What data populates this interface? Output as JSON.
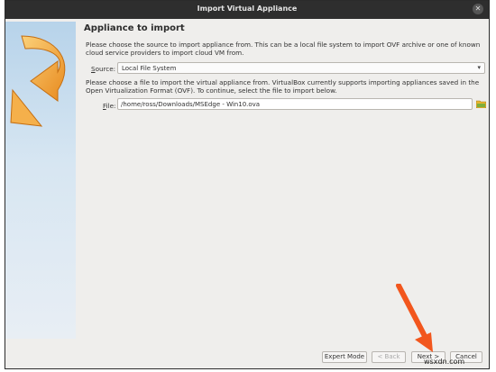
{
  "window": {
    "title": "Import Virtual Appliance",
    "close_icon": "close-icon"
  },
  "heading": "Appliance to import",
  "description_source": "Please choose the source to import appliance from. This can be a local file system to import OVF archive or one of known cloud service providers to import cloud VM from.",
  "source": {
    "label_key": "S",
    "label_rest": "ource:",
    "value": "Local File System"
  },
  "description_file": "Please choose a file to import the virtual appliance from. VirtualBox currently supports importing appliances saved in the Open Virtualization Format (OVF). To continue, select the file to import below.",
  "file": {
    "label_key": "F",
    "label_rest": "ile:",
    "value": "/home/ross/Downloads/MSEdge - Win10.ova"
  },
  "buttons": {
    "expert": "Expert Mode",
    "back": "< Back",
    "next": "Next >",
    "cancel": "Cancel"
  },
  "watermark": "wsxdn.com",
  "colors": {
    "annotation_arrow": "#f2561d",
    "banner_icon": "#f3a238"
  }
}
